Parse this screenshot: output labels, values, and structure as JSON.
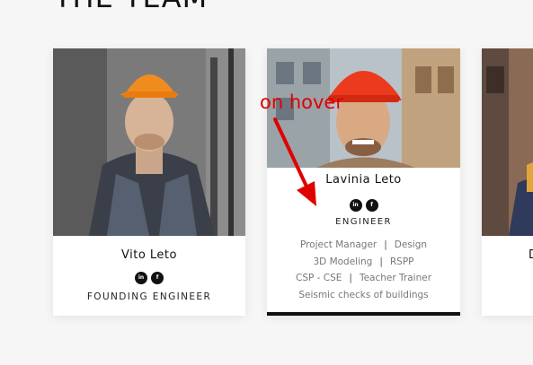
{
  "section": {
    "title": "THE TEAM"
  },
  "cards": [
    {
      "name": "Vito Leto",
      "role": "FOUNDING ENGINEER",
      "socials": [
        "in",
        "f"
      ]
    },
    {
      "name": "Lavinia Leto",
      "role": "ENGINEER",
      "socials": [
        "in",
        "f"
      ],
      "skills": {
        "row1": [
          "Project Manager",
          "Design"
        ],
        "row2": [
          "3D Modeling",
          "RSPP"
        ],
        "row3": [
          "CSP - CSE",
          "Teacher Trainer"
        ],
        "row4": "Seismic checks of buildings"
      }
    },
    {
      "name_partial": "D"
    }
  ],
  "annotation": {
    "text": "on hover"
  },
  "colors": {
    "annotation": "#e00000",
    "card_bg": "#ffffff",
    "accent_bar": "#111111"
  }
}
